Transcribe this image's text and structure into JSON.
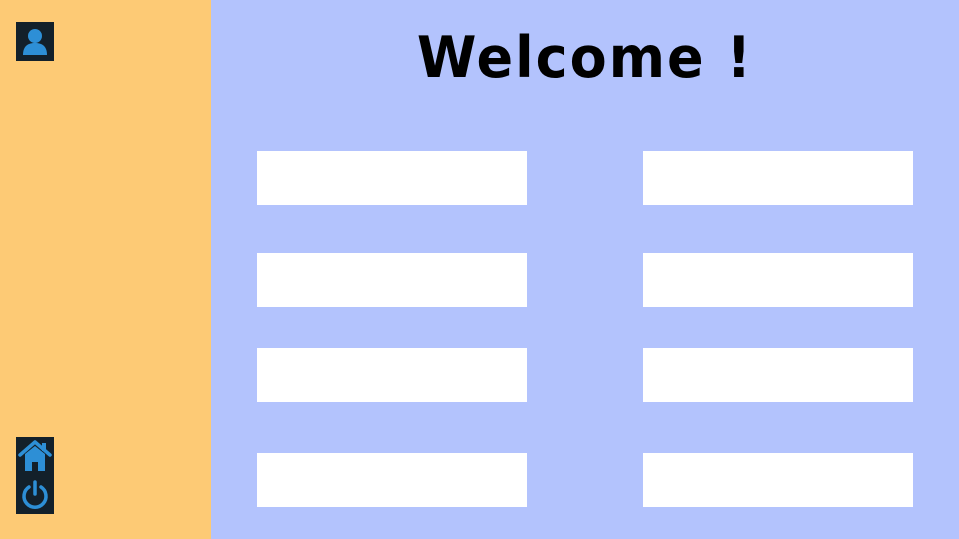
{
  "page": {
    "title": "Welcome !"
  },
  "sidebar": {
    "top_icon": "user-profile-icon",
    "bottom_icons": [
      "home-icon",
      "power-icon"
    ],
    "background_color": "#fdca75",
    "icon_color": "#2d8fd6",
    "icon_background_color": "#13202a"
  },
  "main": {
    "background_color": "#b3c3fd",
    "fields": [
      {
        "value": "",
        "placeholder": ""
      },
      {
        "value": "",
        "placeholder": ""
      },
      {
        "value": "",
        "placeholder": ""
      },
      {
        "value": "",
        "placeholder": ""
      },
      {
        "value": "",
        "placeholder": ""
      },
      {
        "value": "",
        "placeholder": ""
      },
      {
        "value": "",
        "placeholder": ""
      },
      {
        "value": "",
        "placeholder": ""
      }
    ]
  }
}
